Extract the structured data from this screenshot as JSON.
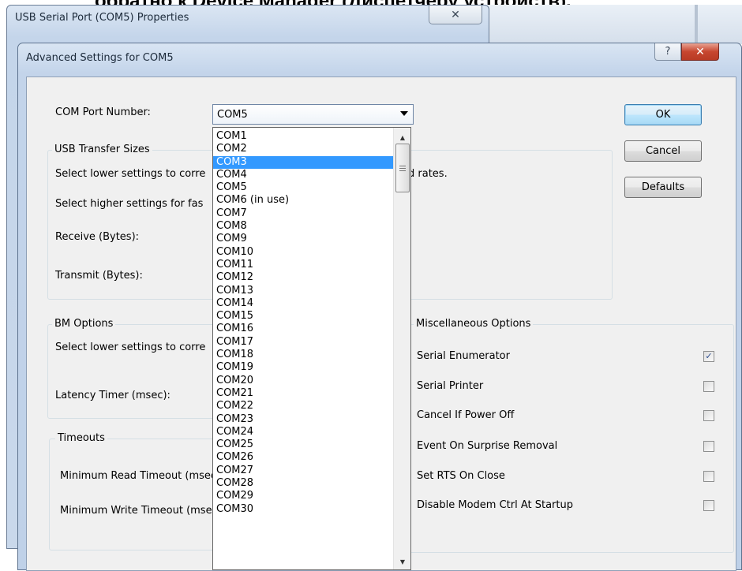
{
  "background_heading": "обратно к Device Manager (Диспетчеру устройств).",
  "parent_window": {
    "title": "USB Serial Port (COM5) Properties",
    "close_glyph": "✕"
  },
  "dialog": {
    "title": "Advanced Settings for COM5",
    "help_glyph": "?",
    "close_glyph": "✕"
  },
  "com_port": {
    "label": "COM Port Number:",
    "selected": "COM5",
    "highlighted": "COM3",
    "options": [
      "COM1",
      "COM2",
      "COM3",
      "COM4",
      "COM5",
      "COM6 (in use)",
      "COM7",
      "COM8",
      "COM9",
      "COM10",
      "COM11",
      "COM12",
      "COM13",
      "COM14",
      "COM15",
      "COM16",
      "COM17",
      "COM18",
      "COM19",
      "COM20",
      "COM21",
      "COM22",
      "COM23",
      "COM24",
      "COM25",
      "COM26",
      "COM27",
      "COM28",
      "COM29",
      "COM30"
    ]
  },
  "usb_transfer": {
    "caption": "USB Transfer Sizes",
    "line1": "Select lower settings to corre",
    "line1_tail": "d rates.",
    "line2": "Select higher settings for fas",
    "receive_label": "Receive (Bytes):",
    "transmit_label": "Transmit (Bytes):"
  },
  "bm_options": {
    "caption": "BM Options",
    "line1": "Select lower settings to corre",
    "latency_label": "Latency Timer (msec):"
  },
  "timeouts": {
    "caption": "Timeouts",
    "read_label": "Minimum Read Timeout (msec",
    "write_label": "Minimum Write Timeout (mse"
  },
  "misc": {
    "caption": "Miscellaneous Options",
    "options": [
      {
        "label": "Serial Enumerator",
        "checked": true
      },
      {
        "label": "Serial Printer",
        "checked": false
      },
      {
        "label": "Cancel If Power Off",
        "checked": false
      },
      {
        "label": "Event On Surprise Removal",
        "checked": false
      },
      {
        "label": "Set RTS On Close",
        "checked": false
      },
      {
        "label": "Disable Modem Ctrl At Startup",
        "checked": false
      }
    ]
  },
  "buttons": {
    "ok": "OK",
    "cancel": "Cancel",
    "defaults": "Defaults"
  },
  "icons": {
    "check": "✓",
    "scroll_up": "▲",
    "scroll_down": "▼"
  }
}
